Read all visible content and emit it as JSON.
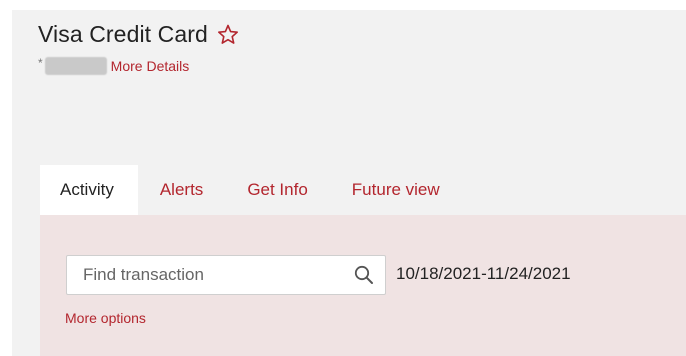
{
  "account": {
    "title": "Visa Credit Card",
    "mask_prefix": "*",
    "more_details_label": "More Details"
  },
  "tabs": [
    {
      "label": "Activity",
      "active": true
    },
    {
      "label": "Alerts",
      "active": false
    },
    {
      "label": "Get Info",
      "active": false
    },
    {
      "label": "Future view",
      "active": false
    }
  ],
  "search": {
    "placeholder": "Find transaction",
    "value": ""
  },
  "date_range": "10/18/2021-11/24/2021",
  "more_options_label": "More options",
  "icons": {
    "favorite": "star-outline-icon",
    "search": "magnifier-icon"
  },
  "colors": {
    "accent": "#b3262e",
    "page_background": "#f2f2f2",
    "panel_background": "#f0e3e3"
  }
}
